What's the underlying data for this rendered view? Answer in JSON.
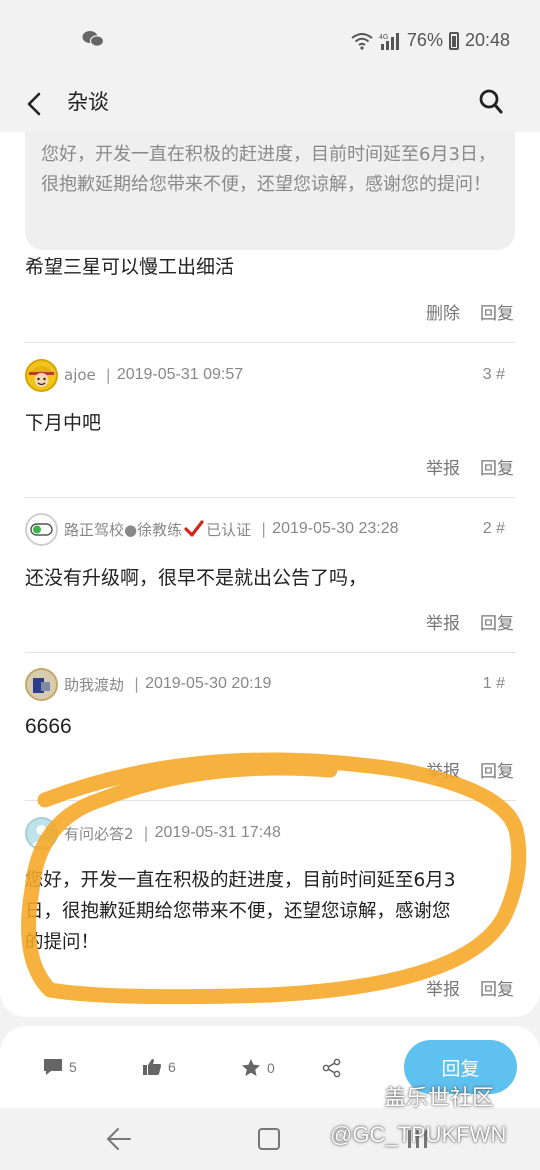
{
  "status_bar": {
    "battery": "76%",
    "time": "20:48",
    "network": "4G"
  },
  "app_bar": {
    "title": "杂谈"
  },
  "quoted_reply": {
    "text": "您好，开发一直在积极的赶进度，目前时间延至6月3日，很抱歉延期给您带来不便，还望您谅解，感谢您的提问！"
  },
  "posts": [
    {
      "content": "希望三星可以慢工出细活",
      "actions": [
        "删除",
        "回复"
      ]
    },
    {
      "user": "ajoe",
      "time": "2019-05-31 09:57",
      "floor": "3 #",
      "content": "下月中吧",
      "actions": [
        "举报",
        "回复"
      ]
    },
    {
      "user": "路正驾校●徐教练",
      "verified": "已认证",
      "time": "2019-05-30 23:28",
      "floor": "2 #",
      "content": "还没有升级啊，很早不是就出公告了吗，",
      "actions": [
        "举报",
        "回复"
      ]
    },
    {
      "user": "助我渡劫",
      "time": "2019-05-30 20:19",
      "floor": "1 #",
      "content": "6666",
      "actions": [
        "举报",
        "回复"
      ]
    },
    {
      "user": "有问必答2",
      "time": "2019-05-31 17:48",
      "content_lines": [
        "您好，开发一直在积极的赶进度，目前时间延至6月3",
        "日，很抱歉延期给您带来不便，还望您谅解，感谢您",
        "的提问！"
      ],
      "actions": [
        "举报",
        "回复"
      ]
    }
  ],
  "bottom_bar": {
    "comments": "5",
    "likes": "6",
    "favorites": "0",
    "reply_label": "回复"
  },
  "watermark": {
    "line1": "盖乐世社区",
    "line2": "@GC_TPUKFWN"
  },
  "colors": {
    "accent": "#5ec1ef",
    "highlight": "#f5a623"
  },
  "icons": [
    "wechat-icon",
    "wifi-icon",
    "signal-icon",
    "battery-icon",
    "back-arrow-icon",
    "search-icon",
    "comment-icon",
    "thumbs-up-icon",
    "star-icon",
    "share-icon",
    "nav-back-icon",
    "nav-home-icon",
    "nav-recents-icon"
  ]
}
